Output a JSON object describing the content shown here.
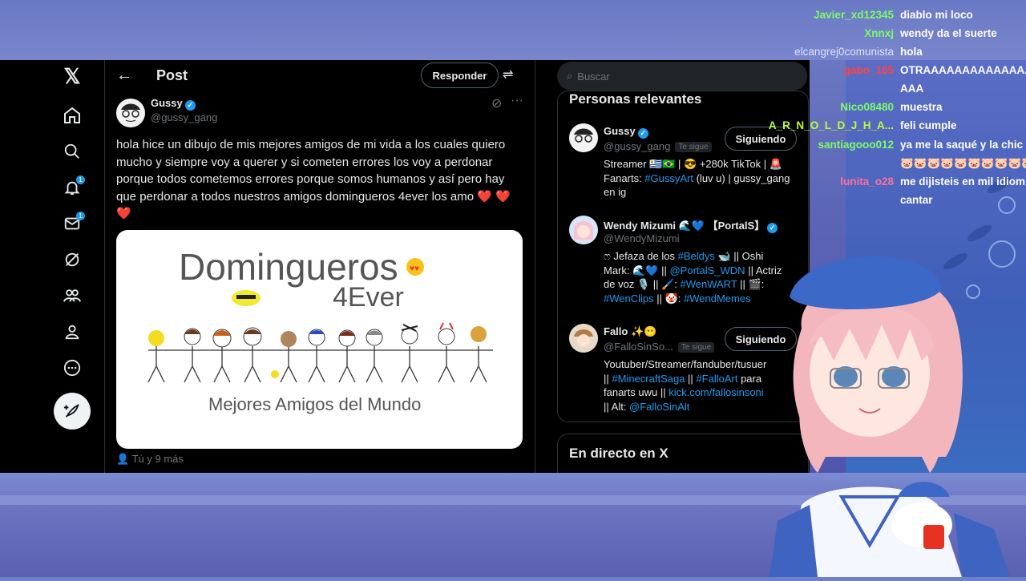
{
  "x_app": {
    "nav": {
      "items": [
        {
          "name": "home",
          "icon": "home-icon"
        },
        {
          "name": "explore",
          "icon": "search-icon"
        },
        {
          "name": "notifications",
          "icon": "bell-icon",
          "badge": "1"
        },
        {
          "name": "messages",
          "icon": "mail-icon",
          "badge": "1"
        },
        {
          "name": "grok",
          "icon": "grok-icon"
        },
        {
          "name": "communities",
          "icon": "people-icon"
        },
        {
          "name": "profile",
          "icon": "person-icon"
        },
        {
          "name": "more",
          "icon": "more-circle-icon"
        }
      ]
    },
    "header": {
      "title": "Post",
      "reply_label": "Responder"
    },
    "post": {
      "author_name": "Gussy",
      "author_handle": "@gussy_gang",
      "text": "hola hice un dibujo de mis mejores amigos de mi vida a los cuales quiero mucho y siempre voy a querer y si cometen errores los voy a perdonar porque todos cometemos errores porque somos humanos y así pero hay que perdonar a todos nuestros amigos domingueros 4ever los amo",
      "hearts": "❤️ ❤️❤️",
      "drawing_title": "Domingueros",
      "drawing_subtitle": "4Ever",
      "drawing_caption": "Mejores Amigos del Mundo",
      "likes_text": "Tú y 9 más"
    },
    "sidebar": {
      "search_placeholder": "Buscar",
      "relevant_title": "Personas relevantes",
      "live_title": "En directo en X",
      "people": [
        {
          "name": "Gussy",
          "handle": "@gussy_gang",
          "follows_you": "Te sigue",
          "button": "Siguiendo",
          "bio": [
            "Streamer 🇺🇾🇧🇷 | 😎 +280k TikTok | 🚨",
            "Fanarts: ",
            "#GussyArt",
            " (luv u) | gussy_gang",
            "en ig"
          ]
        },
        {
          "name": "Wendy Mizumi 🌊💙 【PortalS】",
          "handle": "@WendyMizumi",
          "bio_line1": "ෆ Jefaza de los ",
          "bio_link1": "#Beldys",
          "bio_line1b": " 🐋 || Oshi",
          "bio_line2": "Mark: 🌊💙 || ",
          "bio_link2": "@PortalS_WDN",
          "bio_line2b": " || Actriz",
          "bio_line3": "de voz 🎙️ || 🖌️: ",
          "bio_link3": "#WenWART",
          "bio_line3b": " || 🎬:",
          "bio_link4": "#WenClips",
          "bio_line4b": " || 🤡: ",
          "bio_link5": "#WendMemes"
        },
        {
          "name": "Fallo ✨😶",
          "handle": "@FalloSinSo...",
          "follows_you": "Te sigue",
          "button": "Siguiendo",
          "bio_line1": "Youtuber/Streamer/fanduber/tusuer",
          "bio_line2": "|| ",
          "bio_link2": "#MinecraftSaga",
          "bio_line2b": " || ",
          "bio_link2b": "#FalloArt",
          "bio_line2c": " para",
          "bio_line3": "fanarts uwu || ",
          "bio_link3": "kick.com/fallosinsoni",
          "bio_line4": "|| Alt: ",
          "bio_link4": "@FalloSinAlt"
        }
      ]
    }
  },
  "chat": [
    {
      "user": "Javier_xd12345",
      "color": "#7CFC6A",
      "msg": "diablo mi loco"
    },
    {
      "user": "Xnnxj",
      "color": "#7CFC6A",
      "msg": "wendy da el suerte"
    },
    {
      "user": "elcangrej0comunista",
      "color": "#dde3ff",
      "msg": "hola"
    },
    {
      "user": "gabo_165",
      "color": "#ff4444",
      "msg": "OTRAAAAAAAAAAAAAA"
    },
    {
      "user": "",
      "color": "#ffffff",
      "msg": "AAA"
    },
    {
      "user": "Nico08480",
      "color": "#7CFC6A",
      "msg": "muestra"
    },
    {
      "user": "A_R_N_O_L_D_J_H_A...",
      "color": "#b8ff3a",
      "msg": "feli cumple"
    },
    {
      "user": "santiagooo012",
      "color": "#7CFC6A",
      "msg": "ya me la saqué y la chic"
    },
    {
      "user": "",
      "color": "#ffffff",
      "msg": "🐷🐷🐷🐷🐷🐷🐷🐷🐷🐷"
    },
    {
      "user": "lunita_o28",
      "color": "#ff6fa0",
      "msg": "me dijisteis en mil idiom"
    },
    {
      "user": "",
      "color": "#ffffff",
      "msg": "cantar"
    }
  ],
  "colors": {
    "accent": "#1d9bf0",
    "like": "#f91880",
    "bg": "#000000"
  }
}
